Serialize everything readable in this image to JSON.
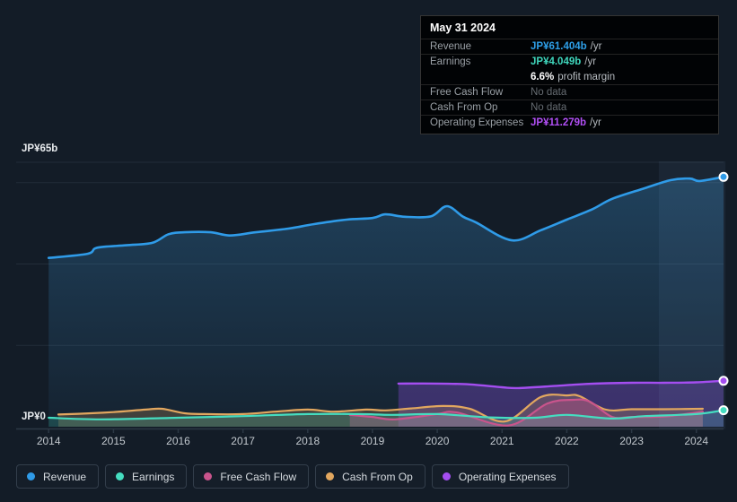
{
  "colors": {
    "background": "#131C27",
    "grid": "#222D39",
    "axis": "#2C3845",
    "highlight_band": "rgba(130,170,215,0.08)"
  },
  "tooltip": {
    "date": "May 31 2024",
    "rows": [
      {
        "label": "Revenue",
        "value": "JP¥61.404b",
        "suffix": "/yr",
        "color": "#2E9FE8"
      },
      {
        "label": "Earnings",
        "value": "JP¥4.049b",
        "suffix": "/yr",
        "color": "#3FD6BC",
        "sub": {
          "bold": "6.6%",
          "text": "profit margin"
        }
      },
      {
        "label": "Free Cash Flow",
        "value": "No data",
        "muted": true
      },
      {
        "label": "Cash From Op",
        "value": "No data",
        "muted": true
      },
      {
        "label": "Operating Expenses",
        "value": "JP¥11.279b",
        "suffix": "/yr",
        "color": "#B14FF5"
      }
    ]
  },
  "legend": {
    "items": [
      {
        "label": "Revenue",
        "color": "#2F9BE8"
      },
      {
        "label": "Earnings",
        "color": "#45DDC0"
      },
      {
        "label": "Free Cash Flow",
        "color": "#C9548C"
      },
      {
        "label": "Cash From Op",
        "color": "#E2A75F"
      },
      {
        "label": "Operating Expenses",
        "color": "#A44EF0"
      }
    ]
  },
  "chart_data": {
    "type": "area",
    "unit": "JP¥ billions per year",
    "x_labels": [
      "2014",
      "2015",
      "2016",
      "2017",
      "2018",
      "2019",
      "2020",
      "2021",
      "2022",
      "2023",
      "2024"
    ],
    "y_axis": {
      "top_label": "JP¥65b",
      "zero_label": "JP¥0",
      "max_b": 65,
      "gridline_values_b": [
        65,
        60,
        40,
        20
      ]
    },
    "highlight_span_years": [
      2023.42,
      2024.45
    ],
    "series": [
      {
        "name": "Revenue",
        "color": "#2F9BE8",
        "width": 2.6,
        "end_dot": true,
        "fill_gradient": [
          "rgba(61,152,216,0.30)",
          "rgba(61,152,216,0.05)"
        ],
        "points": [
          [
            2014,
            41.5
          ],
          [
            2014.6,
            42.5
          ],
          [
            2014.75,
            44.0
          ],
          [
            2015.2,
            44.6
          ],
          [
            2015.6,
            45.2
          ],
          [
            2015.85,
            47.3
          ],
          [
            2016.1,
            47.8
          ],
          [
            2016.5,
            47.8
          ],
          [
            2016.8,
            47.0
          ],
          [
            2017.2,
            47.8
          ],
          [
            2017.7,
            48.7
          ],
          [
            2018.1,
            49.8
          ],
          [
            2018.6,
            50.9
          ],
          [
            2019.0,
            51.3
          ],
          [
            2019.2,
            52.2
          ],
          [
            2019.5,
            51.6
          ],
          [
            2019.9,
            51.7
          ],
          [
            2020.15,
            54.2
          ],
          [
            2020.4,
            51.6
          ],
          [
            2020.6,
            50.2
          ],
          [
            2021.15,
            45.8
          ],
          [
            2021.6,
            48.3
          ],
          [
            2022.0,
            50.9
          ],
          [
            2022.4,
            53.5
          ],
          [
            2022.7,
            56.0
          ],
          [
            2023.2,
            58.6
          ],
          [
            2023.6,
            60.6
          ],
          [
            2023.9,
            61.0
          ],
          [
            2024.05,
            60.4
          ],
          [
            2024.42,
            61.404
          ]
        ]
      },
      {
        "name": "Operating Expenses",
        "color": "#A44EF0",
        "width": 2.4,
        "end_dot": true,
        "fill": "rgba(148,78,235,0.30)",
        "points": [
          [
            2019.4,
            10.6
          ],
          [
            2020.0,
            10.6
          ],
          [
            2020.5,
            10.4
          ],
          [
            2021.0,
            9.7
          ],
          [
            2021.25,
            9.5
          ],
          [
            2021.8,
            10.0
          ],
          [
            2022.3,
            10.5
          ],
          [
            2023.0,
            10.8
          ],
          [
            2023.5,
            10.8
          ],
          [
            2024.0,
            10.9
          ],
          [
            2024.42,
            11.279
          ]
        ]
      },
      {
        "name": "Cash From Op",
        "color": "#E2A75F",
        "width": 2.2,
        "end_dot": false,
        "fill": "rgba(224,169,95,0.22)",
        "points": [
          [
            2014.15,
            3.0
          ],
          [
            2014.5,
            3.2
          ],
          [
            2015.0,
            3.6
          ],
          [
            2015.5,
            4.2
          ],
          [
            2015.75,
            4.4
          ],
          [
            2016.1,
            3.3
          ],
          [
            2016.4,
            3.1
          ],
          [
            2017.0,
            3.1
          ],
          [
            2017.5,
            3.7
          ],
          [
            2018.0,
            4.2
          ],
          [
            2018.4,
            3.7
          ],
          [
            2018.9,
            4.2
          ],
          [
            2019.2,
            4.0
          ],
          [
            2019.6,
            4.5
          ],
          [
            2020.1,
            5.1
          ],
          [
            2020.5,
            4.4
          ],
          [
            2021.05,
            1.3
          ],
          [
            2021.6,
            7.3
          ],
          [
            2022.0,
            7.7
          ],
          [
            2022.2,
            7.5
          ],
          [
            2022.6,
            4.2
          ],
          [
            2023.0,
            4.3
          ],
          [
            2023.5,
            4.3
          ],
          [
            2024.1,
            4.4
          ]
        ]
      },
      {
        "name": "Free Cash Flow",
        "color": "#C9548C",
        "width": 2.2,
        "end_dot": false,
        "fill": "rgba(201,84,140,0.35)",
        "points": [
          [
            2018.65,
            2.9
          ],
          [
            2019.0,
            2.4
          ],
          [
            2019.35,
            1.8
          ],
          [
            2020.0,
            3.1
          ],
          [
            2020.3,
            3.5
          ],
          [
            2021.1,
            0.3
          ],
          [
            2021.7,
            5.7
          ],
          [
            2022.1,
            6.6
          ],
          [
            2022.35,
            6.2
          ],
          [
            2022.7,
            2.4
          ],
          [
            2023.0,
            2.4
          ],
          [
            2023.5,
            2.5
          ],
          [
            2024.1,
            3.7
          ]
        ]
      },
      {
        "name": "Earnings",
        "color": "#45DDC0",
        "width": 2.2,
        "end_dot": true,
        "fill": "rgba(72,214,189,0.20)",
        "points": [
          [
            2014.0,
            2.2
          ],
          [
            2014.8,
            1.8
          ],
          [
            2016.0,
            2.2
          ],
          [
            2017.0,
            2.6
          ],
          [
            2018.0,
            3.1
          ],
          [
            2018.8,
            3.1
          ],
          [
            2019.3,
            2.9
          ],
          [
            2020.0,
            3.1
          ],
          [
            2020.8,
            2.3
          ],
          [
            2021.5,
            2.2
          ],
          [
            2022.0,
            2.9
          ],
          [
            2022.7,
            2.0
          ],
          [
            2023.2,
            2.6
          ],
          [
            2024.0,
            3.1
          ],
          [
            2024.42,
            4.049
          ]
        ]
      }
    ]
  }
}
